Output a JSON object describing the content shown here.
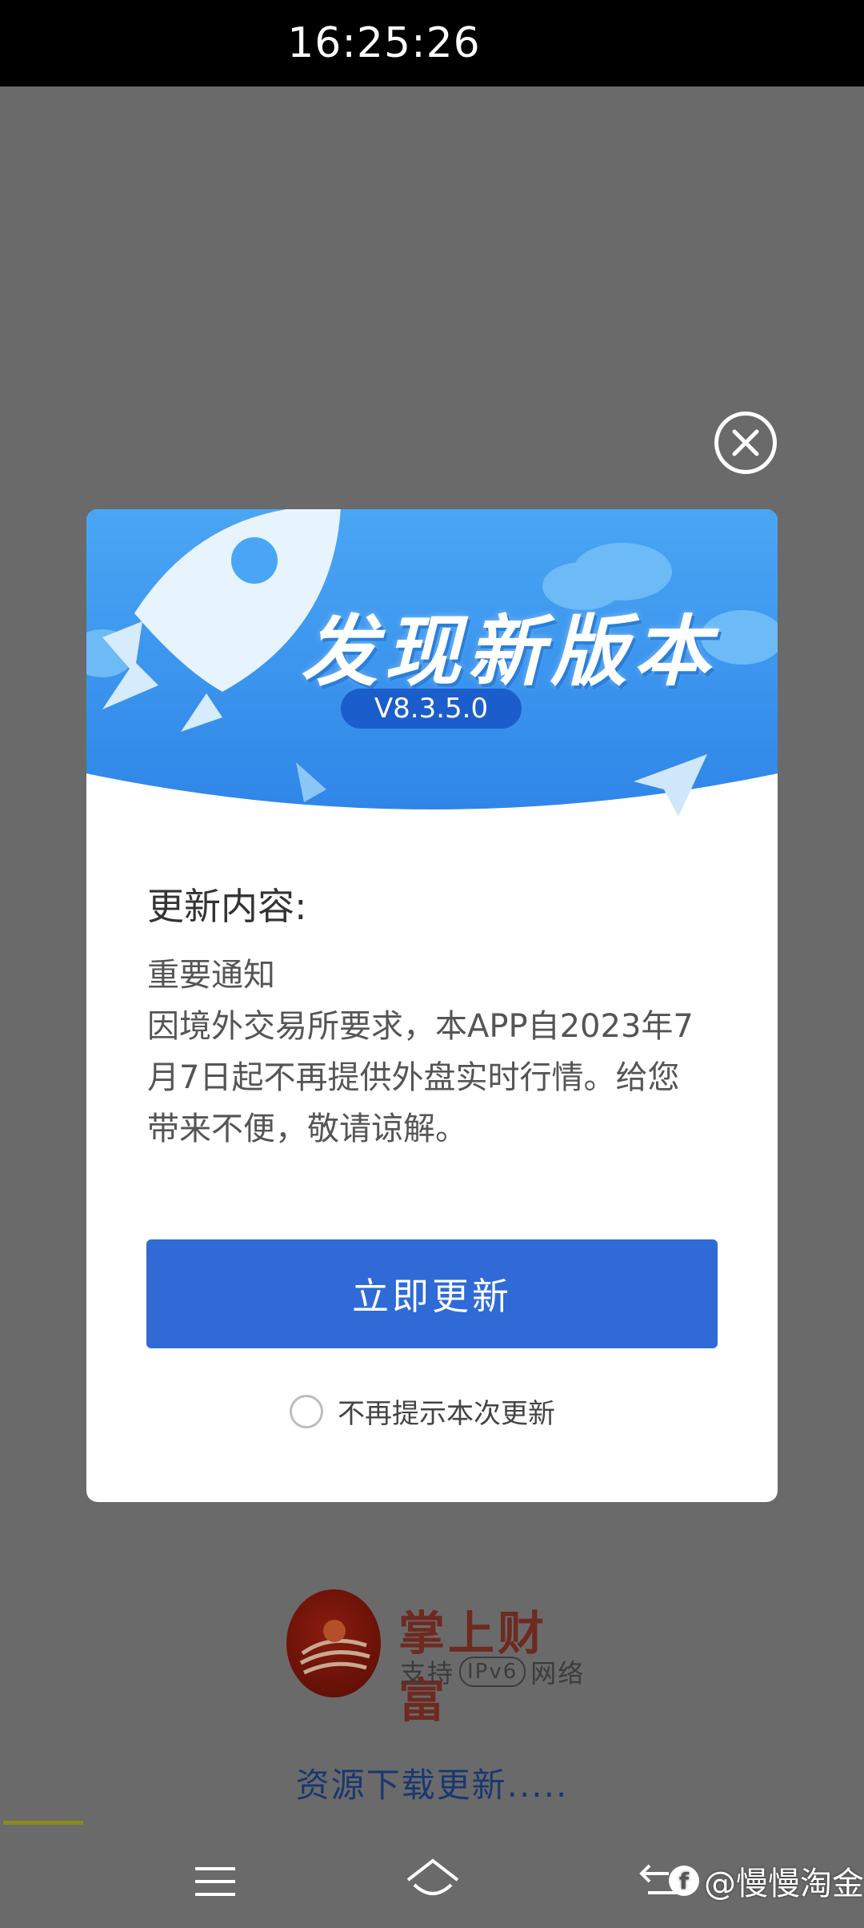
{
  "status_bar": {
    "time": "16:25:26"
  },
  "dialog": {
    "banner_title": "发现新版本",
    "version": "V8.3.5.0",
    "content_title": "更新内容:",
    "content_body": "重要通知\n因境外交易所要求，本APP自2023年7\n月7日起不再提供外盘实时行情。给您\n带来不便，敬请谅解。",
    "update_button": "立即更新",
    "skip_label": "不再提示本次更新",
    "colors": {
      "banner_blue": "#3d9bf0",
      "button_blue": "#2f6ad7",
      "pill_blue": "#1b5ecb"
    }
  },
  "background_app": {
    "brand_name": "掌上财富",
    "brand_sub_prefix": "支持",
    "brand_sub_badge": "IPv6",
    "brand_sub_suffix": "网络",
    "loading_text": "资源下载更新....."
  },
  "nav": {
    "icons": [
      "menu-icon",
      "home-icon",
      "back-icon"
    ]
  },
  "watermark": {
    "logo": "f",
    "text": "@慢慢淘金"
  }
}
